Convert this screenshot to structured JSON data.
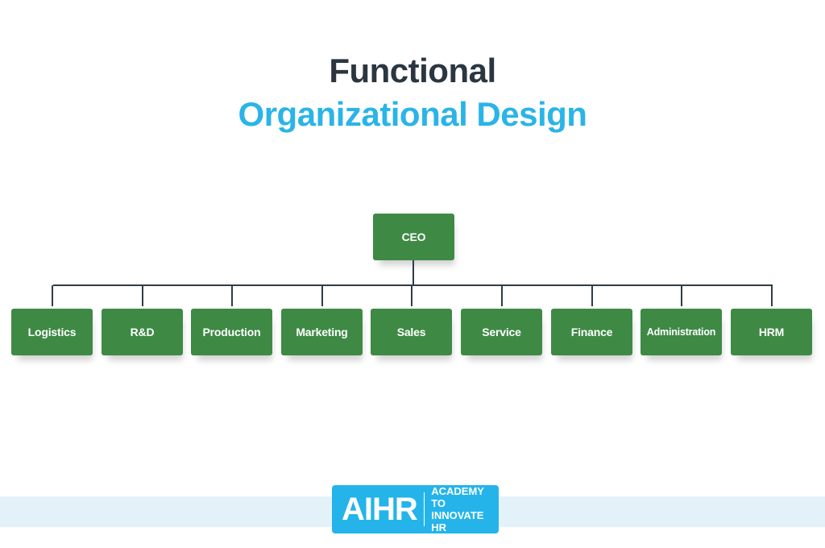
{
  "title": {
    "line1": "Functional",
    "line2": "Organizational Design"
  },
  "colors": {
    "title_dark": "#2b3640",
    "title_accent": "#2ab4e8",
    "box_fill": "#3e8a45",
    "connector": "#2e3d48",
    "band": "#e3f2f8",
    "logo_bg": "#24b4ea"
  },
  "chart": {
    "root": "CEO",
    "departments": [
      "Logistics",
      "R&D",
      "Production",
      "Marketing",
      "Sales",
      "Service",
      "Finance",
      "Administration",
      "HRM"
    ]
  },
  "logo": {
    "mark": "AIHR",
    "text_line1": "ACADEMY TO",
    "text_line2": "INNOVATE HR"
  }
}
